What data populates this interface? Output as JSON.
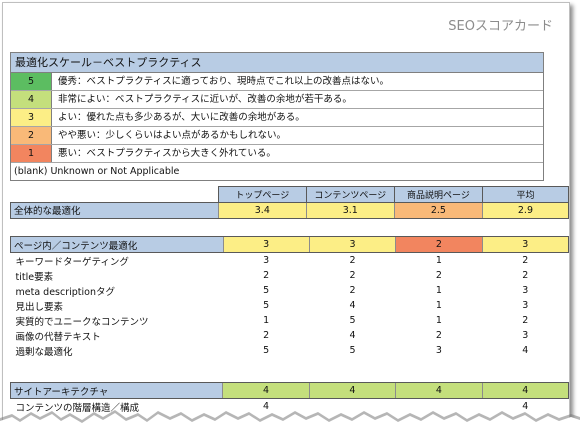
{
  "title": "SEOスコアカード",
  "colors": {
    "green": "#5cbd61",
    "lightgreen": "#c4df7c",
    "yellow": "#fcee86",
    "orange": "#f9b978",
    "red": "#f2855f",
    "header": "#b8cce4"
  },
  "scale": {
    "header": "最適化スケール－ベストプラクティス",
    "items": [
      {
        "num": "5",
        "desc": "優秀：ベストプラクティスに適っており、現時点でこれ以上の改善点はない。",
        "color": "#5cbd61"
      },
      {
        "num": "4",
        "desc": "非常によい：ベストプラクティスに近いが、改善の余地が若干ある。",
        "color": "#c4df7c"
      },
      {
        "num": "3",
        "desc": "よい：優れた点も多少あるが、大いに改善の余地がある。",
        "color": "#fcee86"
      },
      {
        "num": "2",
        "desc": "やや悪い：少しくらいはよい点があるかもしれない。",
        "color": "#f9b978"
      },
      {
        "num": "1",
        "desc": "悪い：ベストプラクティスから大きく外れている。",
        "color": "#f2855f"
      }
    ],
    "blank_label": "(blank)",
    "blank_desc": "Unknown or Not Applicable"
  },
  "columns": [
    "トップページ",
    "コンテンツページ",
    "商品説明ページ",
    "平均"
  ],
  "overall": {
    "label": "全体的な最適化",
    "values": [
      "3.4",
      "3.1",
      "2.5",
      "2.9"
    ],
    "colors": [
      "#fcee86",
      "#fcee86",
      "#f9b978",
      "#fcee86"
    ]
  },
  "onpage": {
    "label": "ページ内／コンテンツ最適化",
    "values": [
      "3",
      "3",
      "2",
      "3"
    ],
    "colors": [
      "#fcee86",
      "#fcee86",
      "#f2855f",
      "#fcee86"
    ],
    "rows": [
      {
        "label": "キーワードターゲティング",
        "values": [
          "3",
          "2",
          "1",
          "2"
        ]
      },
      {
        "label": "title要素",
        "values": [
          "2",
          "2",
          "2",
          "2"
        ]
      },
      {
        "label": "meta descriptionタグ",
        "values": [
          "5",
          "2",
          "1",
          "3"
        ]
      },
      {
        "label": "見出し要素",
        "values": [
          "5",
          "4",
          "1",
          "3"
        ]
      },
      {
        "label": "実質的でユニークなコンテンツ",
        "values": [
          "1",
          "5",
          "1",
          "2"
        ]
      },
      {
        "label": "画像の代替テキスト",
        "values": [
          "2",
          "4",
          "2",
          "3"
        ]
      },
      {
        "label": "過剰な最適化",
        "values": [
          "5",
          "5",
          "3",
          "4"
        ]
      }
    ]
  },
  "architecture": {
    "label": "サイトアーキテクチャ",
    "values": [
      "4",
      "4",
      "4",
      "4"
    ],
    "colors": [
      "#c4df7c",
      "#c4df7c",
      "#c4df7c",
      "#c4df7c"
    ],
    "rows": [
      {
        "label": "コンテンツの階層構造／構成",
        "values": [
          "4",
          "",
          "",
          "4"
        ]
      }
    ]
  }
}
